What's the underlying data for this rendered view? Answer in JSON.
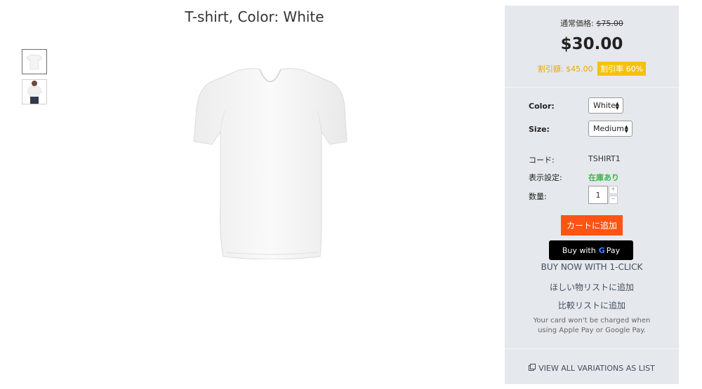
{
  "product": {
    "title": "T-shirt, Color: White"
  },
  "thumbnails": [
    {
      "name": "white tshirt front",
      "active": true
    },
    {
      "name": "model wearing tshirt",
      "active": false
    }
  ],
  "panel": {
    "regular_label": "通常価格:",
    "regular_price": "$75.00",
    "price": "$30.00",
    "discount_amount": "割引額: $45.00",
    "discount_badge": "割引率 60%",
    "color_label": "Color:",
    "color_value": "White",
    "size_label": "Size:",
    "size_value": "Medium",
    "code_label": "コード:",
    "code_value": "TSHIRT1",
    "availability_label": "表示設定:",
    "availability_value": "在庫あり",
    "quantity_label": "数量:",
    "quantity_value": "1",
    "qty_plus": "+",
    "qty_minus": "−",
    "add_to_cart": "カートに追加",
    "gpay_prefix": "Buy with",
    "gpay_brand": "G",
    "gpay_pay": "Pay",
    "buy_now": "BUY NOW WITH 1-CLICK",
    "wishlist": "ほしい物リストに追加",
    "compare": "比較リストに追加",
    "note": "Your card won't be charged when using Apple Pay or Google Pay.",
    "view_all": "VIEW ALL VARIATIONS AS LIST"
  },
  "colors": {
    "panel_bg": "#e5e8ec",
    "add_cart": "#ff5415",
    "discount_text": "#f0a500",
    "discount_badge": "#f4c20d",
    "in_stock": "#3bb54a"
  },
  "icons": {
    "gpay": "google-pay-icon",
    "view_all": "copy-icon",
    "select_arrows": "sort-arrows-icon"
  }
}
